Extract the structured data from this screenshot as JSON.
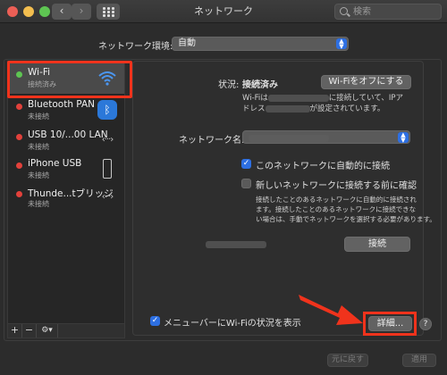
{
  "window": {
    "title": "ネットワーク"
  },
  "search": {
    "placeholder": "検索"
  },
  "location": {
    "label": "ネットワーク環境:",
    "value": "自動"
  },
  "services": [
    {
      "name": "Wi-Fi",
      "status": "接続済み",
      "dot_color": "#5ec552",
      "icon": "wifi-icon"
    },
    {
      "name": "Bluetooth PAN",
      "status": "未接続",
      "dot_color": "#e2413b",
      "icon": "bluetooth-icon"
    },
    {
      "name": "USB 10/...00 LAN",
      "status": "未接続",
      "dot_color": "#e2413b",
      "icon": "ethernet-arrows-icon"
    },
    {
      "name": "iPhone USB",
      "status": "未接続",
      "dot_color": "#e2413b",
      "icon": "iphone-icon"
    },
    {
      "name": "Thunde...tブリッジ",
      "status": "未接続",
      "dot_color": "#e2413b",
      "icon": "ethernet-arrows-icon"
    }
  ],
  "sidebar_tools": {
    "add": "+",
    "remove": "−",
    "gear": "⚙▾"
  },
  "detail": {
    "status_label": "状況:",
    "status_value": "接続済み",
    "wifi_off_button": "Wi-Fiをオフにする",
    "info_line1_prefix": "Wi-Fiは",
    "info_line1_suffix": "に接続していて、IPア",
    "info_line2_prefix": "ドレス",
    "info_line2_suffix": "が設定されています。",
    "network_name_label": "ネットワーク名:",
    "auto_join_label": "このネットワークに自動的に接続",
    "ask_join_label": "新しいネットワークに接続する前に確認",
    "ask_join_desc": [
      "接続したことのあるネットワークに自動的に接続され",
      "ます。接続したことのあるネットワークに接続できな",
      "い場合は、手動でネットワークを選択する必要があります。"
    ],
    "connect_button": "接続",
    "show_menu_label": "メニューバーにWi-Fiの状況を表示",
    "advanced_button": "詳細...",
    "help_button": "?"
  },
  "footer": {
    "revert_button": "元に戻す",
    "apply_button": "適用"
  },
  "colors": {
    "accent": "#2d6fe2",
    "highlight": "#f0331c",
    "connected": "#5ec552",
    "disconnected": "#e2413b"
  }
}
